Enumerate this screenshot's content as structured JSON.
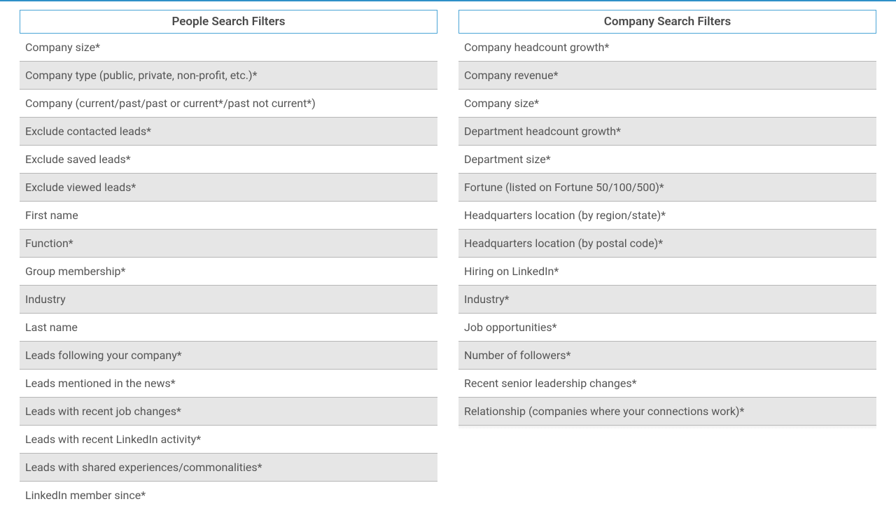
{
  "people": {
    "title": "People Search Filters",
    "items": [
      "Company size*",
      "Company type (public, private, non-profit, etc.)*",
      "Company (current/past/past or current*/past not current*)",
      "Exclude contacted leads*",
      "Exclude saved leads*",
      "Exclude viewed leads*",
      "First name",
      "Function*",
      "Group membership*",
      "Industry",
      "Last name",
      "Leads following your company*",
      "Leads mentioned in the news*",
      "Leads with recent job changes*",
      "Leads with recent LinkedIn activity*",
      "Leads with shared experiences/commonalities*",
      "LinkedIn member since*"
    ]
  },
  "company": {
    "title": "Company Search Filters",
    "items": [
      "Company headcount growth*",
      "Company revenue*",
      "Company size*",
      "Department headcount growth*",
      "Department size*",
      "Fortune (listed on Fortune 50/100/500)*",
      "Headquarters location (by region/state)*",
      "Headquarters location (by postal code)*",
      "Hiring on LinkedIn*",
      "Industry*",
      "Job opportunities*",
      "Number of followers*",
      "Recent senior leadership changes*",
      "Relationship (companies where your connections work)*"
    ]
  }
}
